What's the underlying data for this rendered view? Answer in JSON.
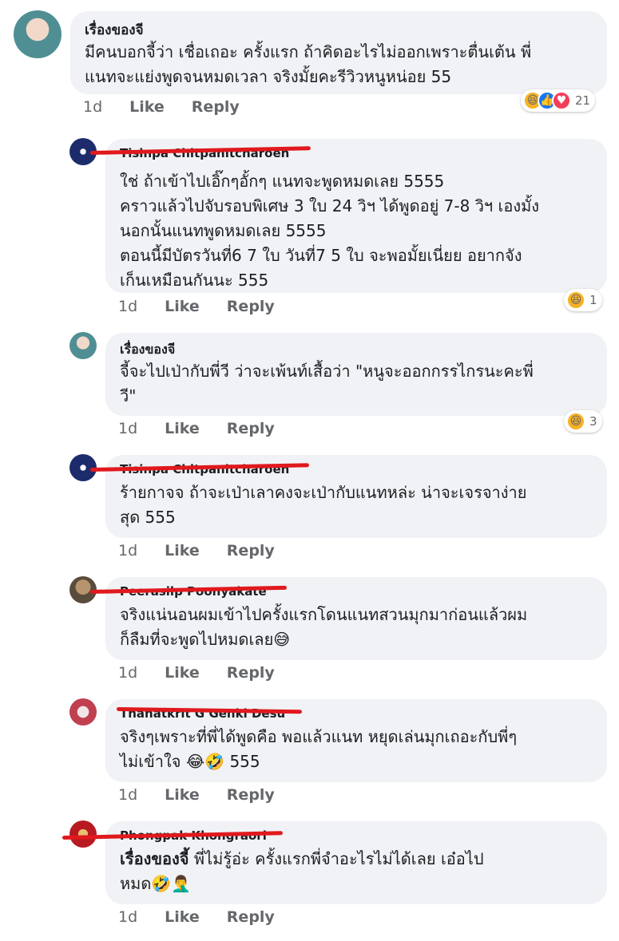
{
  "actions": {
    "like": "Like",
    "reply": "Reply"
  },
  "comments": [
    {
      "author": "เรื่องของจี",
      "author_redacted": false,
      "lines": [
        "มีคนบอกจี้ว่า เชื่อเถอะ ครั้งแรก ถ้าคิดอะไรไม่ออกเพราะตื่นเต้น พี่",
        "แนทจะแย่งพูดจนหมดเวลา จริงมั้ยคะรีวิวหนูหน่อย 55"
      ],
      "time": "1d",
      "reactions": [
        "haha",
        "like",
        "love"
      ],
      "reaction_count": "21"
    },
    {
      "author": "Tisinpa Chitpanitcharoen",
      "author_redacted": true,
      "lines": [
        "ใช่ ถ้าเข้าไปเอิ๊กๆอั้กๆ แนทจะพูดหมดเลย 5555",
        "คราวแล้วไปจับรอบพิเศษ 3 ใบ 24 วิฯ ได้พูดอยู่ 7-8 วิฯ เองมั้ง",
        "นอกนั้นแนทพูดหมดเลย 5555",
        "ตอนนี้มีบัตรวันที่6 7 ใบ วันที่7 5 ใบ จะพอมั้ยเนี่ยย อยากจัง",
        "เก็นเหมือนกันนะ 555"
      ],
      "time": "1d",
      "reactions": [
        "haha"
      ],
      "reaction_count": "1"
    },
    {
      "author": "เรื่องของจี",
      "author_redacted": false,
      "lines": [
        "จี้จะไปเป่ากับพี่วี ว่าจะเพ้นท์เสื้อว่า \"หนูจะออกกรรไกรนะคะพี่",
        "วี\""
      ],
      "time": "1d",
      "reactions": [
        "haha"
      ],
      "reaction_count": "3"
    },
    {
      "author": "Tisinpa Chitpanitcharoen",
      "author_redacted": true,
      "lines": [
        "ร้ายกาจจ ถ้าจะเป่าเลาคงจะเป่ากับแนทหล่ะ น่าจะเจรจาง่าย",
        "สุด 555"
      ],
      "time": "1d",
      "reactions": [],
      "reaction_count": ""
    },
    {
      "author": "Peerasilp Poonyakate",
      "author_redacted": true,
      "lines": [
        "จริงแน่นอนผมเข้าไปครั้งแรกโดนแนทสวนมุกมาก่อนแล้วผม",
        "ก็ลืมที่จะพูดไปหมดเลย😅"
      ],
      "time": "1d",
      "reactions": [],
      "reaction_count": ""
    },
    {
      "author": "Thanatkrit G Genki Desu",
      "author_redacted": true,
      "lines": [
        "จริงๆเพราะที่พี่ได้พูดคือ พอแล้วแนท หยุดเล่นมุกเถอะกับพี่ๆ",
        "ไม่เข้าใจ 😂🤣 555"
      ],
      "time": "1d",
      "reactions": [],
      "reaction_count": ""
    },
    {
      "author": "Phongpak Khongraori",
      "author_redacted": true,
      "mention": "เรื่องของจี้",
      "lines": [
        " พี่ไม่รู้อ่ะ ครั้งแรกพี่จำอะไรไม่ได้เลย เอ๋อไป",
        "หมด🤣🤦‍♂️"
      ],
      "time": "1d",
      "reactions": [],
      "reaction_count": ""
    }
  ]
}
